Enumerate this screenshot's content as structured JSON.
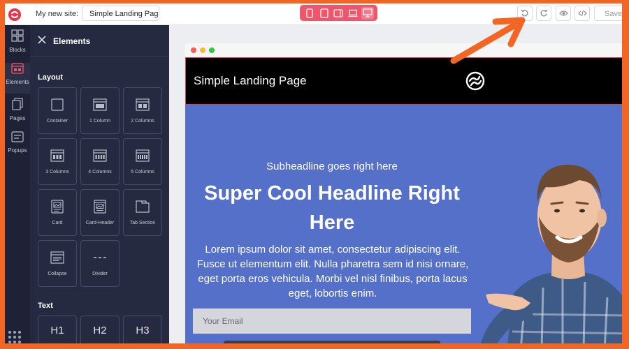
{
  "topbar": {
    "site_label": "My new site:",
    "site_name": "Simple Landing Page",
    "saved_label": "Saved"
  },
  "rail": {
    "items": [
      {
        "label": "Blocks"
      },
      {
        "label": "Elements"
      },
      {
        "label": "Pages"
      },
      {
        "label": "Popups"
      }
    ]
  },
  "panel": {
    "title": "Elements",
    "layout_title": "Layout",
    "text_title": "Text",
    "layout_tiles": [
      {
        "label": "Container"
      },
      {
        "label": "1 Column"
      },
      {
        "label": "2 Columns"
      },
      {
        "label": "3 Columns"
      },
      {
        "label": "4 Columns"
      },
      {
        "label": "5 Columns"
      },
      {
        "label": "Card"
      },
      {
        "label": "Card-Header"
      },
      {
        "label": "Tab Section"
      },
      {
        "label": "Collapse"
      },
      {
        "label": "Divider"
      }
    ],
    "text_tiles": [
      {
        "label": "H1"
      },
      {
        "label": "H2"
      },
      {
        "label": "H3"
      }
    ]
  },
  "page": {
    "header_title": "Simple Landing Page",
    "subheadline": "Subheadline goes right here",
    "headline": "Super Cool Headline Right Here",
    "body": "Lorem ipsum dolor sit amet, consectetur adipiscing elit. Fusce ut elementum elit. Nulla pharetra sem id nisi ornare, eget porta eros vehicula. Morbi vel nisl finibus, porta lacus eget, lobortis enim.",
    "email_placeholder": "Your Email"
  },
  "colors": {
    "frame": "#f26522",
    "panel": "#262a40",
    "rail": "#1f2236",
    "device_bar": "#f0566b",
    "hero": "#5470c8",
    "arrow": "#f26522"
  },
  "icons": [
    "logo-icon",
    "close-icon",
    "blocks-icon",
    "elements-icon",
    "pages-icon",
    "popups-icon",
    "grid-dots-icon",
    "undo-icon",
    "redo-icon",
    "eye-icon",
    "code-icon",
    "mobile-icon",
    "tablet-icon",
    "tablet-landscape-icon",
    "laptop-icon",
    "desktop-icon"
  ]
}
